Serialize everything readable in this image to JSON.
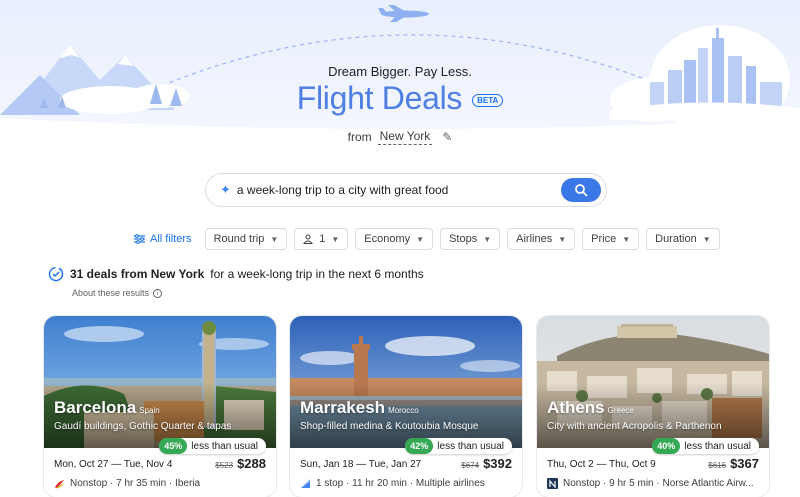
{
  "header": {
    "tagline": "Dream Bigger. Pay Less.",
    "title": "Flight Deals",
    "badge": "BETA",
    "from_label": "from",
    "from_city": "New York"
  },
  "search": {
    "query": "a week-long trip to a city with great food"
  },
  "filters": {
    "all_filters": "All filters",
    "chips": [
      "Round trip",
      "1",
      "Economy",
      "Stops",
      "Airlines",
      "Price",
      "Duration"
    ]
  },
  "results": {
    "count_text": "31 deals from New York",
    "rest_text": "for a week-long trip in the next 6 months",
    "about": "About these results"
  },
  "deals": [
    {
      "city": "Barcelona",
      "country": "Spain",
      "description": "Gaudí buildings, Gothic Quarter & tapas",
      "percent": "45%",
      "percent_label": "less than usual",
      "dates": "Mon, Oct 27 — Tue, Nov 4",
      "old_price": "$523",
      "price": "$288",
      "flight": "Nonstop · 7 hr 35 min · Iberia"
    },
    {
      "city": "Marrakesh",
      "country": "Morocco",
      "description": "Shop-filled medina & Koutoubia Mosque",
      "percent": "42%",
      "percent_label": "less than usual",
      "dates": "Sun, Jan 18 — Tue, Jan 27",
      "old_price": "$674",
      "price": "$392",
      "flight": "1 stop · 11 hr 20 min · Multiple airlines"
    },
    {
      "city": "Athens",
      "country": "Greece",
      "description": "City with ancient Acropolis & Parthenon",
      "percent": "40%",
      "percent_label": "less than usual",
      "dates": "Thu, Oct 2 — Thu, Oct 9",
      "old_price": "$616",
      "price": "$367",
      "flight": "Nonstop · 9 hr 5 min · Norse Atlantic Airw..."
    }
  ],
  "colors": {
    "brand_blue": "#4f7fe3",
    "link_blue": "#1a73e8",
    "deal_green": "#34a853"
  }
}
